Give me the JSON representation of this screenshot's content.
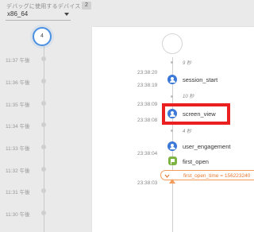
{
  "header": {
    "label": "デバッグに使用するデバイス",
    "device_count": "2",
    "device_value": "x86_64"
  },
  "minutes": {
    "current_count": "4",
    "labels": [
      "11:37 午後",
      "11:36 午後",
      "11:35 午後",
      "11:34 午後",
      "11:33 午後",
      "11:32 午後",
      "11:31 午後",
      "11:30 午後"
    ]
  },
  "events": {
    "gap1": "9 秒",
    "time_session_start_a": "23:38:20",
    "time_session_start_b": "23:38:19",
    "session_start": "session_start",
    "gap2": "10 秒",
    "time_screen_view_a": "23:38:09",
    "time_screen_view_b": "23:38:08",
    "screen_view": "screen_view",
    "gap3": "4 秒",
    "user_engagement": "user_engagement",
    "time_first_open": "23:38:04",
    "first_open": "first_open",
    "time_param": "23:38:03",
    "param_text": "first_open_time = 156223240"
  },
  "colors": {
    "accent_blue": "#3b78d8",
    "highlight_red": "#ea1f1f",
    "param_orange": "#e8772e",
    "first_open_green": "#7cb342"
  }
}
